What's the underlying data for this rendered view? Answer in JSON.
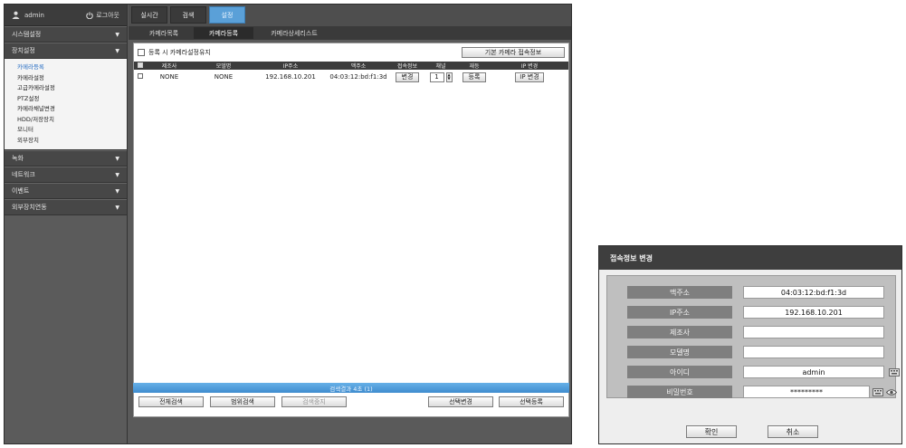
{
  "sidebar": {
    "username": "admin",
    "logout_label": "로그아웃",
    "menus": [
      {
        "label": "시스템설정"
      },
      {
        "label": "장치설정",
        "expanded": true,
        "items": [
          {
            "label": "카메라등록",
            "active": true
          },
          {
            "label": "카메라설정"
          },
          {
            "label": "고급카메라설정"
          },
          {
            "label": "PTZ설정"
          },
          {
            "label": "카메라채널변경"
          },
          {
            "label": "HDD/저장장치"
          },
          {
            "label": "모니터"
          },
          {
            "label": "외부장치"
          }
        ]
      },
      {
        "label": "녹화"
      },
      {
        "label": "네트워크"
      },
      {
        "label": "이벤트"
      },
      {
        "label": "외부장치연동"
      }
    ]
  },
  "top_tabs": [
    {
      "label": "실시간"
    },
    {
      "label": "검색"
    },
    {
      "label": "설정",
      "active": true
    }
  ],
  "sub_tabs": [
    {
      "label": "카메라목록"
    },
    {
      "label": "카메라등록",
      "active": true
    },
    {
      "label": "카메라상세리스트"
    }
  ],
  "toolbar": {
    "checkbox_label": "등록 시 카메라설정유지",
    "default_access_button": "기본 카메라 접속정보"
  },
  "table": {
    "columns": [
      "제조사",
      "모델명",
      "IP주소",
      "맥주소",
      "접속정보",
      "채널",
      "재등",
      "IP 변경"
    ],
    "rows": [
      {
        "manufacturer": "NONE",
        "model": "NONE",
        "ip": "192.168.10.201",
        "mac": "04:03:12:bd:f1:3d",
        "access_button": "변경",
        "channel": "1",
        "register_button": "등록",
        "ip_change_button": "IP 변경"
      }
    ]
  },
  "result_bar": "검색결과 4초 (1)",
  "bottom_buttons": {
    "full_search": "전체검색",
    "partial_search": "범위검색",
    "stop_search": "검색중지",
    "select_change": "선택변경",
    "select_register": "선택등록"
  },
  "dialog": {
    "title": "접속정보 변경",
    "fields": [
      {
        "label": "맥주소",
        "value": "04:03:12:bd:f1:3d"
      },
      {
        "label": "IP주소",
        "value": "192.168.10.201"
      },
      {
        "label": "제조사",
        "value": ""
      },
      {
        "label": "모델명",
        "value": ""
      },
      {
        "label": "아이디",
        "value": "admin"
      },
      {
        "label": "비밀번호",
        "value": "*********"
      }
    ],
    "confirm_label": "확인",
    "cancel_label": "취소"
  },
  "colors": {
    "accent": "#5aa0d8",
    "active_menu_text": "#2a6fc4",
    "result_bar": "#4a98d6"
  }
}
